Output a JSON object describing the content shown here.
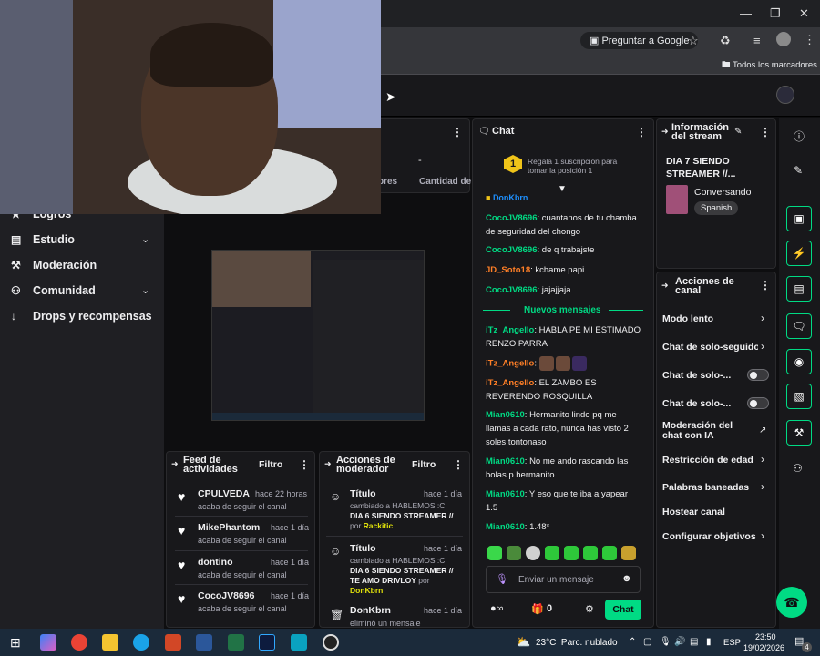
{
  "browser": {
    "translate_chip": "Preguntar a Google",
    "bookmarks": "Todos los marcadores"
  },
  "sidebar": {
    "items": [
      {
        "label": "Logros"
      },
      {
        "label": "Estudio"
      },
      {
        "label": "Moderación"
      },
      {
        "label": "Comunidad"
      },
      {
        "label": "Drops y recompensas"
      }
    ]
  },
  "stats_panel": {
    "dash": "-",
    "col1": "pres",
    "col2": "Cantidad de"
  },
  "feed": {
    "title_l1": "Feed de",
    "title_l2": "actividades",
    "filter": "Filtro",
    "items": [
      {
        "name": "CPULVEDA",
        "time": "hace 22 horas",
        "sub": "acaba de seguir el canal"
      },
      {
        "name": "MikePhantom",
        "time": "hace 1 día",
        "sub": "acaba de seguir el canal"
      },
      {
        "name": "dontino",
        "time": "hace 1 día",
        "sub": "acaba de seguir el canal"
      },
      {
        "name": "CocoJV8696",
        "time": "hace 1 día",
        "sub": "acaba de seguir el canal"
      }
    ]
  },
  "modactions": {
    "title_l1": "Acciones de",
    "title_l2": "moderador",
    "filter": "Filtro",
    "items": [
      {
        "title": "Título",
        "time": "hace 1 día",
        "l1": "cambiado a HABLEMOS :C,",
        "l2": "DIA 6 SIENDO STREAMER //",
        "l3": "por",
        "by": "Rackitic"
      },
      {
        "title": "Título",
        "time": "hace 1 día",
        "l1": "cambiado a HABLEMOS :C,",
        "l2": "DIA 6 SIENDO STREAMER //",
        "l2b": "TE AMO DRIVLOY",
        "l3": "por",
        "by": "DonKbrn"
      },
      {
        "title": "DonKbrn",
        "time": "hace 1 día",
        "l1": "eliminó un mensaje"
      }
    ]
  },
  "chat": {
    "title": "Chat",
    "gift_l1": "Regala 1 suscripción para",
    "gift_l2": "tomar la posición 1",
    "gift_rank": "1",
    "top_user": "DonKbrn",
    "new_messages": "Nuevos mensajes",
    "messages": [
      {
        "user": "CocoJV8696",
        "text": "cuantanos de tu chamba de seguridad del chongo"
      },
      {
        "user": "CocoJV8696",
        "text": "de q trabajste"
      },
      {
        "user": "JD_Soto18",
        "text": "kchame papi"
      },
      {
        "user": "CocoJV8696",
        "text": "jajajjaja"
      },
      {
        "user": "iTz_Angello",
        "text": "HABLA PE MI ESTIMADO RENZO PARRA"
      },
      {
        "user": "iTz_Angello",
        "text": ""
      },
      {
        "user": "iTz_Angello",
        "text": "EL ZAMBO ES REVERENDO ROSQUILLA"
      },
      {
        "user": "Mian0610",
        "text": "Hermanito lindo pq me llamas a cada rato, nunca has visto 2 soles tontonaso"
      },
      {
        "user": "Mian0610",
        "text": "No me ando rascando las bolas p hermanito"
      },
      {
        "user": "Mian0610",
        "text": "Y eso que te iba a yapear 1.5"
      },
      {
        "user": "Mian0610",
        "text": "1.48*"
      }
    ],
    "input_placeholder": "Enviar un mensaje",
    "points": "0",
    "send": "Chat"
  },
  "stream_info": {
    "title_l1": "Información",
    "title_l2": "del stream",
    "stream_l1": "DIA 7 SIENDO",
    "stream_l2": "STREAMER //...",
    "category": "Conversando",
    "language": "Spanish"
  },
  "channel_actions": {
    "title_l1": "Acciones de",
    "title_l2": "canal",
    "items": [
      {
        "label": "Modo lento"
      },
      {
        "label": "Chat de solo-seguido"
      },
      {
        "label": "Chat de solo-..."
      },
      {
        "label": "Chat de solo-..."
      },
      {
        "label": "Moderación del chat con IA"
      },
      {
        "label": "Restricción de edad"
      },
      {
        "label": "Palabras baneadas"
      },
      {
        "label": "Hostear canal"
      },
      {
        "label": "Configurar objetivos"
      }
    ]
  },
  "taskbar": {
    "weather": "23°C  Parc. nublado",
    "lang": "ESP",
    "time": "23:50",
    "date": "19/02/2026",
    "notif": "4"
  }
}
